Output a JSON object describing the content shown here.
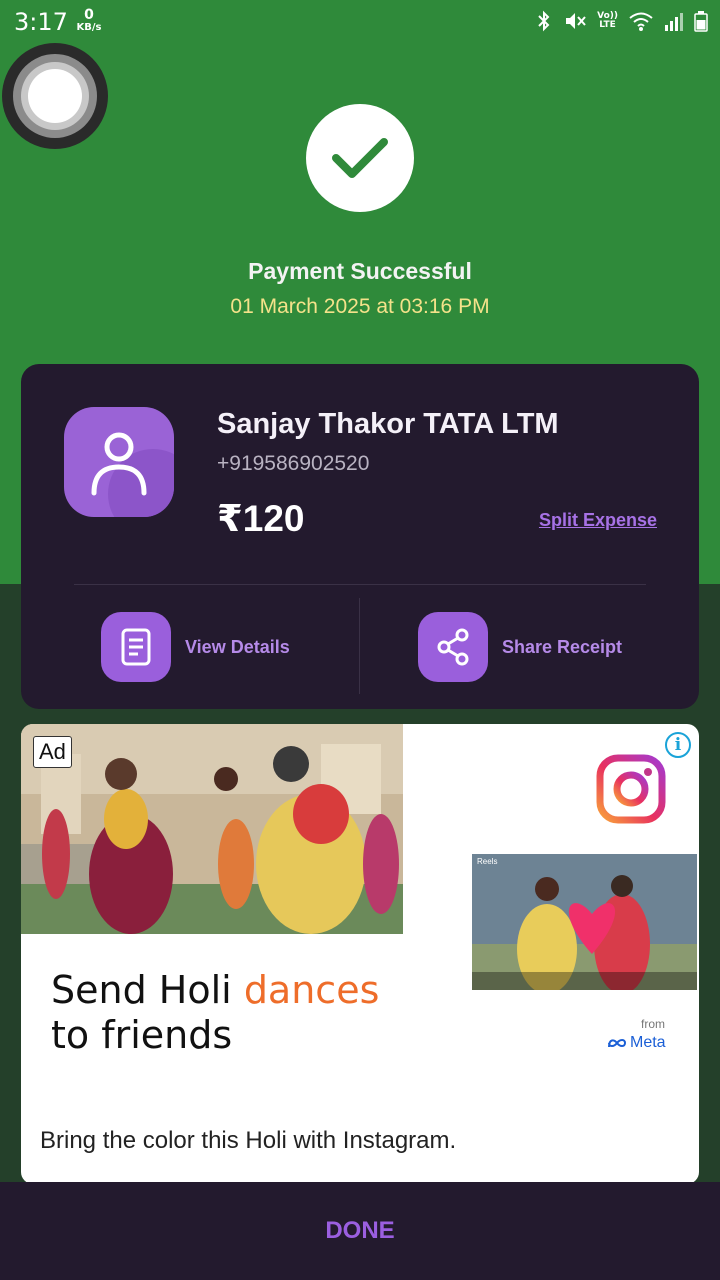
{
  "status_bar": {
    "time": "3:17",
    "net_speed_value": "0",
    "net_speed_unit": "KB/s",
    "volte_top": "Vo))",
    "volte_bottom": "LTE",
    "icons": [
      "bluetooth-icon",
      "mute-vibrate-icon",
      "volte-icon",
      "wifi-icon",
      "signal-icon",
      "battery-icon"
    ]
  },
  "payment": {
    "title": "Payment Successful",
    "datetime": "01 March 2025 at 03:16 PM",
    "payee_name": "Sanjay Thakor TATA LTM",
    "payee_phone": "+919586902520",
    "amount": "₹120",
    "split_label": "Split Expense",
    "view_details_label": "View Details",
    "share_receipt_label": "Share Receipt"
  },
  "ad": {
    "badge": "Ad",
    "info": "i",
    "headline_part1": "Send Holi ",
    "headline_accent": "dances",
    "headline_part2": "to friends",
    "from_label": "from",
    "brand": "Meta",
    "reel_label": "Reels",
    "body": "Bring the color this Holi with Instagram."
  },
  "footer": {
    "done_label": "DONE"
  },
  "colors": {
    "header_green": "#2f8a3a",
    "card_dark": "#231a2e",
    "accent_purple": "#9a5fdc",
    "date_yellow": "#f4e28a",
    "headline_accent": "#ee6d2a"
  }
}
